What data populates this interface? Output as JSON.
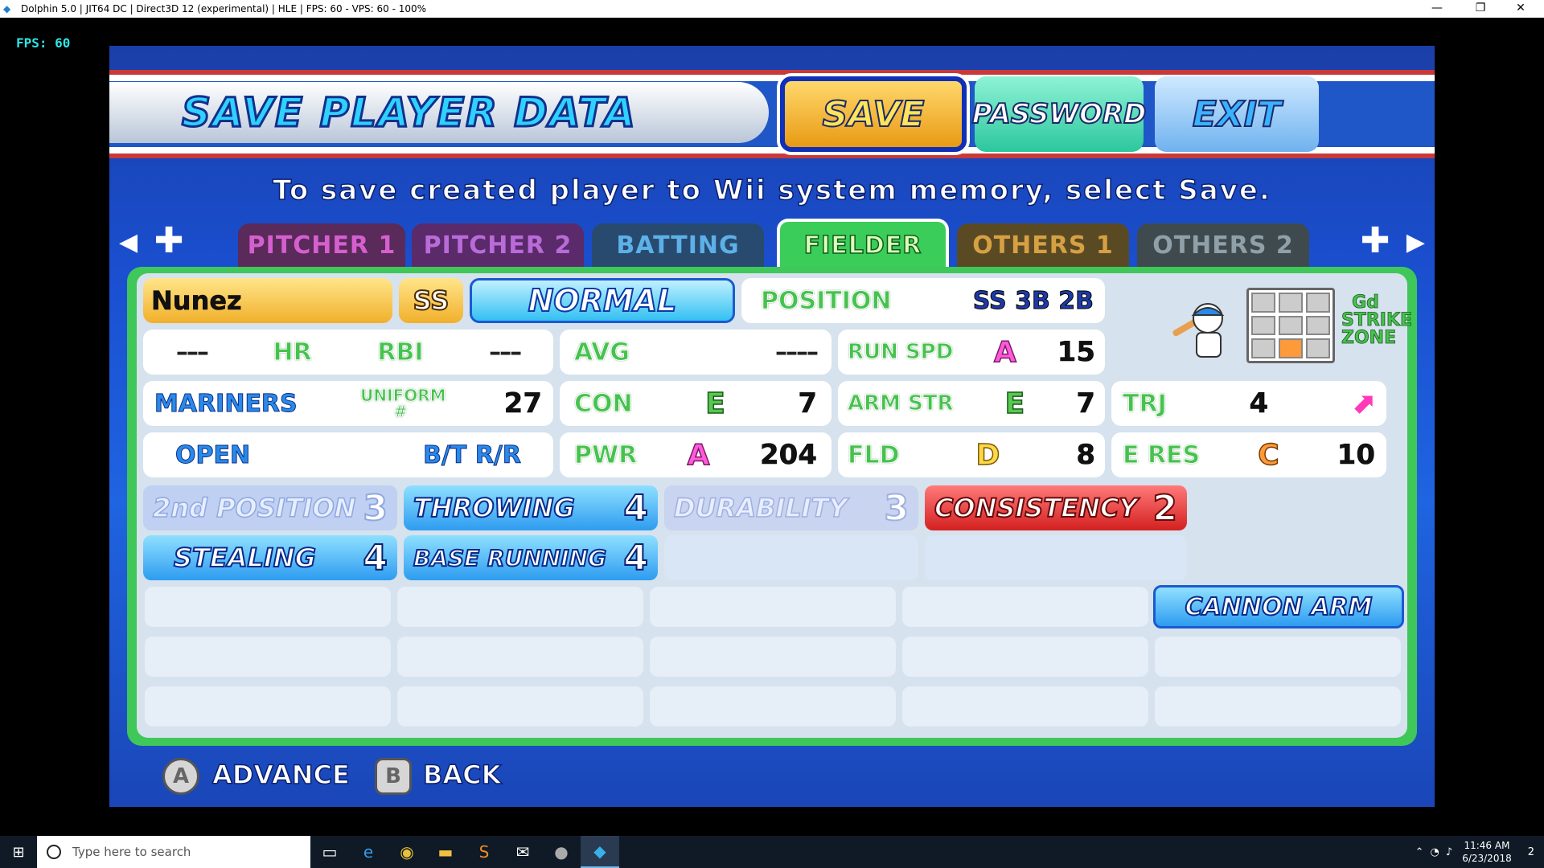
{
  "window": {
    "title": "Dolphin 5.0 | JIT64 DC | Direct3D 12 (experimental) | HLE | FPS: 60 - VPS: 60 - 100%",
    "minimize": "—",
    "restore": "❐",
    "close": "✕",
    "fps_overlay": "FPS: 60"
  },
  "header": {
    "title": "SAVE PLAYER DATA",
    "save": "SAVE",
    "password": "PASSWORD",
    "exit": "EXIT"
  },
  "instruction": "To save created player to Wii system memory, select Save.",
  "tabs": {
    "pitcher1": "PITCHER 1",
    "pitcher2": "PITCHER 2",
    "batting": "BATTING",
    "fielder": "FIELDER",
    "others1": "OTHERS 1",
    "others2": "OTHERS 2",
    "left_arrow": "◀",
    "right_arrow": "▶",
    "dpad": "✚"
  },
  "player": {
    "name": "Nunez",
    "pos_abbr": "SS",
    "form": "NORMAL",
    "position_label": "POSITION",
    "positions": "SS 3B 2B",
    "hr_dash": "–––",
    "hr_label": "HR",
    "rbi_label": "RBI",
    "rbi_dash": "–––",
    "avg_label": "AVG",
    "avg_dash": "––––",
    "run_spd_label": "RUN SPD",
    "run_spd_grade": "A",
    "run_spd_val": "15",
    "team": "MARINERS",
    "uniform_label": "UNIFORM #",
    "uniform_num": "27",
    "con_label": "CON",
    "con_grade": "E",
    "con_val": "7",
    "arm_label": "ARM STR",
    "arm_grade": "E",
    "arm_val": "7",
    "traj_label": "TRJ",
    "traj_val": "4",
    "stance": "OPEN",
    "bt_label": "B/T",
    "bt_val": "R/R",
    "pwr_label": "PWR",
    "pwr_grade": "A",
    "pwr_val": "204",
    "fld_label": "FLD",
    "fld_grade": "D",
    "fld_val": "8",
    "eres_label": "E RES",
    "eres_grade": "C",
    "eres_val": "10",
    "zone_label": "Gd STRIKE ZONE"
  },
  "abilities": {
    "second_position": "2nd POSITION",
    "second_position_val": "3",
    "throwing": "THROWING",
    "throwing_val": "4",
    "durability": "DURABILITY",
    "durability_val": "3",
    "consistency": "CONSISTENCY",
    "consistency_val": "2",
    "stealing": "STEALING",
    "stealing_val": "4",
    "base_running": "BASE RUNNING",
    "base_running_val": "4",
    "cannon_arm": "CANNON ARM"
  },
  "footer": {
    "a_btn": "A",
    "advance": "ADVANCE",
    "b_btn": "B",
    "back": "BACK"
  },
  "taskbar": {
    "search_placeholder": "Type here to search",
    "time": "11:46 AM",
    "date": "6/23/2018",
    "notif_count": "2"
  }
}
